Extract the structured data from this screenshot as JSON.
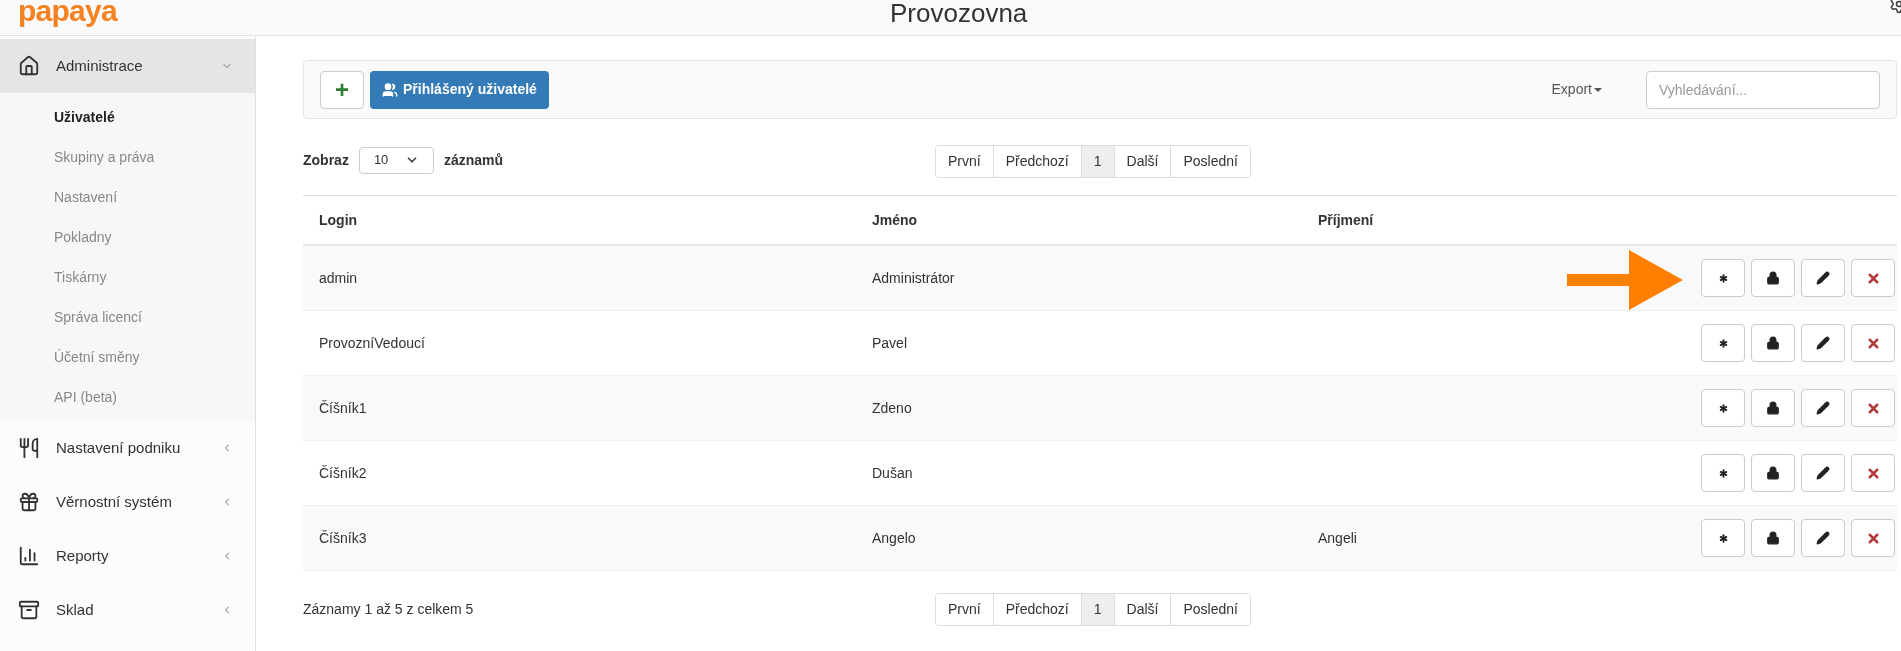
{
  "logo": "papaya",
  "header": {
    "title": "Provozovna"
  },
  "sidebar": {
    "items": [
      {
        "label": "Administrace",
        "expanded": true,
        "children": [
          {
            "label": "Uživatelé",
            "selected": true
          },
          {
            "label": "Skupiny a práva",
            "selected": false
          },
          {
            "label": "Nastavení",
            "selected": false
          },
          {
            "label": "Pokladny",
            "selected": false
          },
          {
            "label": "Tiskárny",
            "selected": false
          },
          {
            "label": "Správa licencí",
            "selected": false
          },
          {
            "label": "Účetní směny",
            "selected": false
          },
          {
            "label": "API (beta)",
            "selected": false
          }
        ]
      },
      {
        "label": "Nastavení podniku",
        "expanded": false
      },
      {
        "label": "Věrnostní systém",
        "expanded": false
      },
      {
        "label": "Reporty",
        "expanded": false
      },
      {
        "label": "Sklad",
        "expanded": false
      }
    ]
  },
  "toolbar": {
    "add_label": "+",
    "logged_users_label": "Přihlášený uživatelé",
    "export_label": "Export",
    "search": {
      "placeholder": "Vyhledávání..."
    }
  },
  "length": {
    "prefix": "Zobraz",
    "value": "10",
    "suffix": "záznamů"
  },
  "pagination_top": [
    {
      "label": "První",
      "selected": false
    },
    {
      "label": "Předchozí",
      "selected": false
    },
    {
      "label": "1",
      "selected": true
    },
    {
      "label": "Další",
      "selected": false
    },
    {
      "label": "Poslední",
      "selected": false
    }
  ],
  "table": {
    "columns": [
      "Login",
      "Jméno",
      "Příjmení"
    ],
    "rows": [
      {
        "login": "admin",
        "name": "Administrátor"
      },
      {
        "login": "ProvozníVedoucí",
        "name": "Pavel"
      },
      {
        "login": "Číšník1",
        "name": "Zdeno"
      },
      {
        "login": "Číšník2",
        "name": "Dušan"
      },
      {
        "login": "Číšník3",
        "name": "Angelo",
        "surname": "Angeli"
      }
    ]
  },
  "info": "Záznamy 1 až 5 z celkem 5",
  "pagination_bottom": [
    {
      "label": "První",
      "selected": false
    },
    {
      "label": "Předchozí",
      "selected": false
    },
    {
      "label": "1",
      "selected": true
    },
    {
      "label": "Další",
      "selected": false
    },
    {
      "label": "Poslední",
      "selected": false
    }
  ]
}
